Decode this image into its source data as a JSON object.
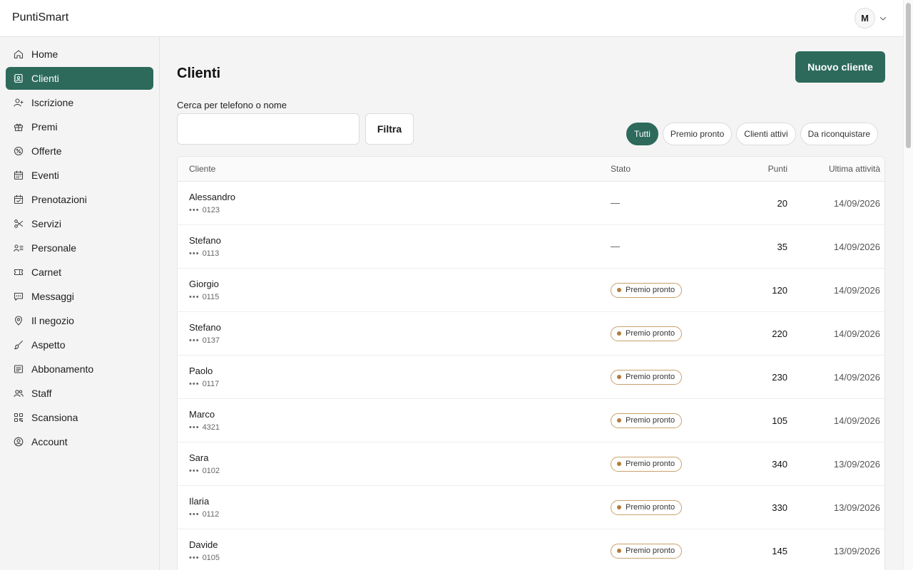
{
  "app": {
    "brand": "PuntiSmart",
    "user_initial": "M"
  },
  "sidebar": {
    "items": [
      {
        "label": "Home",
        "icon": "home-icon",
        "active": false
      },
      {
        "label": "Clienti",
        "icon": "contacts-icon",
        "active": true
      },
      {
        "label": "Iscrizione",
        "icon": "user-plus-icon",
        "active": false
      },
      {
        "label": "Premi",
        "icon": "gift-icon",
        "active": false
      },
      {
        "label": "Offerte",
        "icon": "offer-icon",
        "active": false
      },
      {
        "label": "Eventi",
        "icon": "calendar-icon",
        "active": false
      },
      {
        "label": "Prenotazioni",
        "icon": "calendar-check-icon",
        "active": false
      },
      {
        "label": "Servizi",
        "icon": "scissors-icon",
        "active": false
      },
      {
        "label": "Personale",
        "icon": "staff-list-icon",
        "active": false
      },
      {
        "label": "Carnet",
        "icon": "ticket-icon",
        "active": false
      },
      {
        "label": "Messaggi",
        "icon": "message-icon",
        "active": false
      },
      {
        "label": "Il negozio",
        "icon": "location-pin-icon",
        "active": false
      },
      {
        "label": "Aspetto",
        "icon": "brush-icon",
        "active": false
      },
      {
        "label": "Abbonamento",
        "icon": "receipt-icon",
        "active": false
      },
      {
        "label": "Staff",
        "icon": "users-icon",
        "active": false
      },
      {
        "label": "Scansiona",
        "icon": "qr-icon",
        "active": false
      },
      {
        "label": "Account",
        "icon": "account-circle-icon",
        "active": false
      }
    ]
  },
  "main": {
    "title": "Clienti",
    "new_client_label": "Nuovo cliente",
    "search": {
      "label": "Cerca per telefono o nome",
      "placeholder": "",
      "value": ""
    },
    "filter_label": "Filtra",
    "chips": [
      {
        "label": "Tutti",
        "active": true
      },
      {
        "label": "Premio pronto",
        "active": false
      },
      {
        "label": "Clienti attivi",
        "active": false
      },
      {
        "label": "Da riconquistare",
        "active": false
      }
    ],
    "table": {
      "headers": {
        "client": "Cliente",
        "status": "Stato",
        "points": "Punti",
        "last_activity": "Ultima attività"
      },
      "rows": [
        {
          "name": "Alessandro",
          "phone": "0123",
          "status": "—",
          "badge": false,
          "points": "20",
          "date": "14/09/2026"
        },
        {
          "name": "Stefano",
          "phone": "0113",
          "status": "—",
          "badge": false,
          "points": "35",
          "date": "14/09/2026"
        },
        {
          "name": "Giorgio",
          "phone": "0115",
          "status": "Premio pronto",
          "badge": true,
          "points": "120",
          "date": "14/09/2026"
        },
        {
          "name": "Stefano",
          "phone": "0137",
          "status": "Premio pronto",
          "badge": true,
          "points": "220",
          "date": "14/09/2026"
        },
        {
          "name": "Paolo",
          "phone": "0117",
          "status": "Premio pronto",
          "badge": true,
          "points": "230",
          "date": "14/09/2026"
        },
        {
          "name": "Marco",
          "phone": "4321",
          "status": "Premio pronto",
          "badge": true,
          "points": "105",
          "date": "14/09/2026"
        },
        {
          "name": "Sara",
          "phone": "0102",
          "status": "Premio pronto",
          "badge": true,
          "points": "340",
          "date": "13/09/2026"
        },
        {
          "name": "Ilaria",
          "phone": "0112",
          "status": "Premio pronto",
          "badge": true,
          "points": "330",
          "date": "13/09/2026"
        },
        {
          "name": "Davide",
          "phone": "0105",
          "status": "Premio pronto",
          "badge": true,
          "points": "145",
          "date": "13/09/2026"
        }
      ],
      "phone_mask": "•••"
    }
  },
  "colors": {
    "accent": "#2d6a5c",
    "badge_border": "#c9a06a",
    "badge_dot": "#b07d3a"
  }
}
